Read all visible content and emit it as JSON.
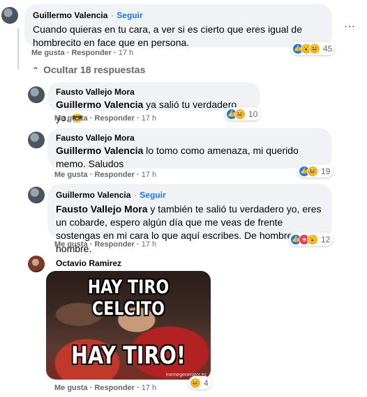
{
  "comments": [
    {
      "name": "Guillermo Valencia",
      "follow": "Seguir",
      "text": "Cuando quieras en tu cara, a ver si es cierto que eres igual de hombrecito en face que en persona.",
      "like": "Me gusta",
      "reply": "Responder",
      "time": "17 h",
      "reaction_count": "45"
    },
    {
      "name": "Fausto Vallejo Mora",
      "mention": "Guillermo Valencia",
      "text": " ya salió tu verdadero yo.",
      "like": "Me gusta",
      "reply": "Responder",
      "time": "17 h",
      "reaction_count": "10"
    },
    {
      "name": "Fausto Vallejo Mora",
      "mention": "Guillermo Valencia",
      "text": " lo tomo como amenaza, mi querido memo. Saludos",
      "like": "Me gusta",
      "reply": "Responder",
      "time": "17 h",
      "reaction_count": "19"
    },
    {
      "name": "Guillermo Valencia",
      "follow": "Seguir",
      "mention": "Fausto Vallejo Mora",
      "text": " y también te salió tu verdadero yo, eres un cobarde, espero algún día que me veas de frente sostengas en mi cara lo que aquí escribes. De hombre a hombre.",
      "like": "Me gusta",
      "reply": "Responder",
      "time": "17 h",
      "reaction_count": "12"
    },
    {
      "name": "Octavio Ramirez",
      "like": "Me gusta",
      "reply": "Responder",
      "time": "17 h",
      "reaction_count": "4"
    }
  ],
  "hide_replies": "Ocultar 18 respuestas",
  "meme": {
    "top_text": "HAY TIRO CELCITO",
    "bottom_text": "HAY TIRO!",
    "watermark": "memegenerator.es"
  },
  "separator": "·",
  "more_icon": "⋯",
  "icons": [
    "like-icon",
    "haha-icon",
    "wow-icon",
    "love-icon",
    "cool-icon",
    "chevron-up-icon",
    "more-options-icon"
  ],
  "colors": {
    "link": "#1877f2",
    "bubble": "#f0f2f5",
    "muted": "#65676b"
  }
}
